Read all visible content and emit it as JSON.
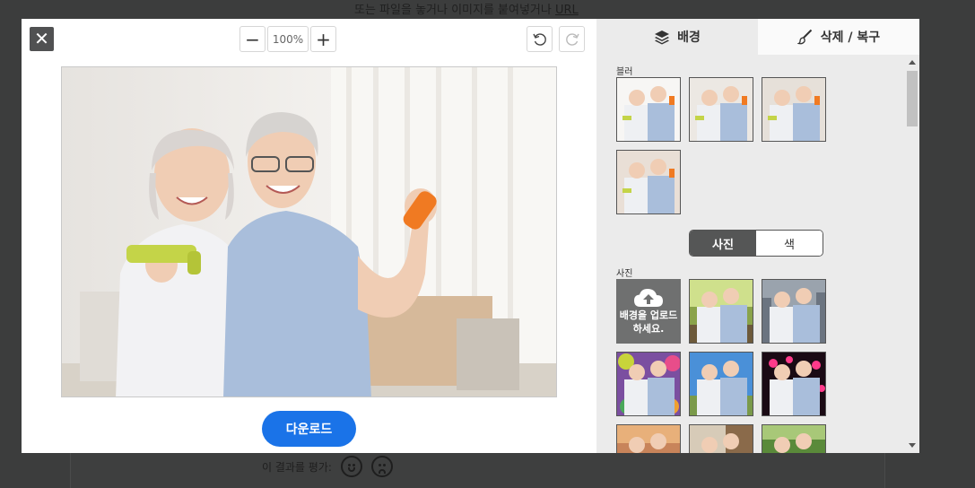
{
  "background_page": {
    "top_text": "또는 파일을 놓거나 이미지를 붙여넣거나",
    "top_link": "URL",
    "rate_label": "이 결과를 평가:"
  },
  "editor": {
    "close_label": "✕",
    "zoom_out_label": "−",
    "zoom_in_label": "+",
    "zoom_value": "100%",
    "download_label": "다운로드"
  },
  "side_panel": {
    "tabs": [
      {
        "label": "배경",
        "icon": "layers-icon"
      },
      {
        "label": "삭제 / 복구",
        "icon": "brush-icon"
      }
    ],
    "blur_label": "블러",
    "toggle": {
      "photo": "사진",
      "color": "색"
    },
    "photo_label": "사진",
    "upload_line1": "배경을 업로드",
    "upload_line2": "하세요."
  },
  "colors": {
    "accent": "#1a73e8",
    "close_bg": "#505152",
    "panel_bg": "#ebebeb",
    "toggle_on": "#555656"
  }
}
